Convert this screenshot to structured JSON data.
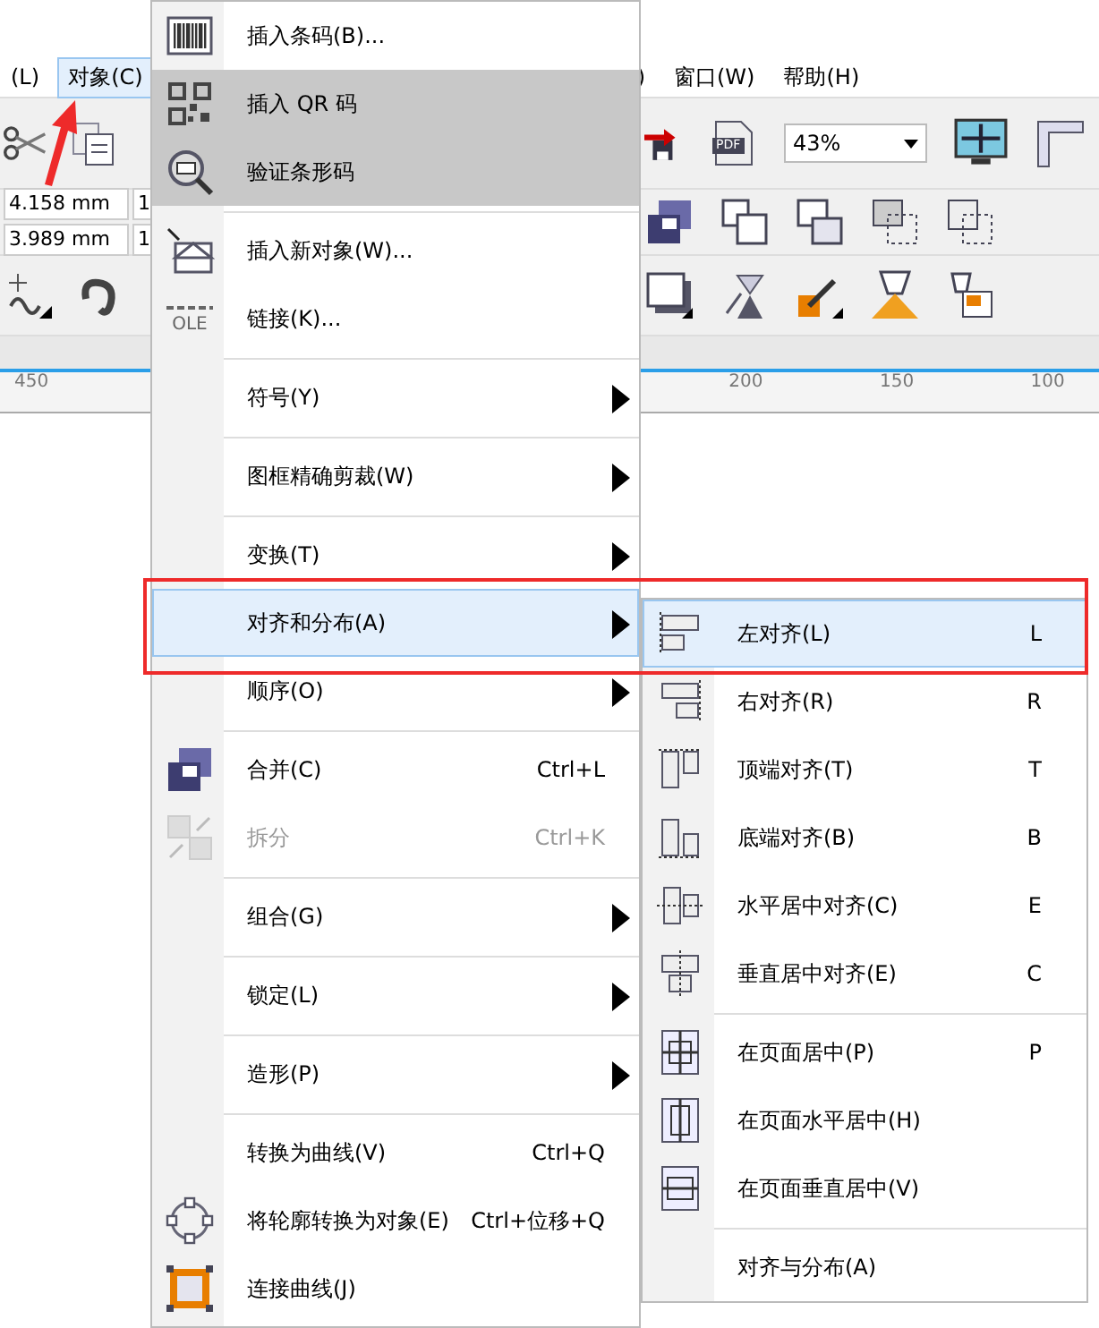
{
  "menubar": {
    "items": [
      {
        "label": "(L)",
        "selected": false
      },
      {
        "label": "对象(C)",
        "selected": true
      },
      {
        "label": ")",
        "selected": false
      },
      {
        "label": "窗口(W)",
        "selected": false
      },
      {
        "label": "帮助(H)",
        "selected": false
      }
    ]
  },
  "toolbar": {
    "zoom": "43%",
    "pdf_label": "PDF",
    "fields": [
      "4.158 mm",
      "1",
      "3.989 mm",
      "1"
    ]
  },
  "ruler": {
    "labels": [
      "450",
      "200",
      "150",
      "100"
    ]
  },
  "menu": {
    "items": [
      {
        "kind": "item",
        "label": "插入条码(B)...",
        "submenu": false,
        "selected": false,
        "disabled": false,
        "shaded": false
      },
      {
        "kind": "item",
        "label": "插入 QR 码",
        "submenu": false,
        "selected": false,
        "disabled": false,
        "shaded": true
      },
      {
        "kind": "item",
        "label": "验证条形码",
        "submenu": false,
        "selected": false,
        "disabled": false,
        "shaded": true
      },
      {
        "kind": "separator"
      },
      {
        "kind": "item",
        "label": "插入新对象(W)...",
        "submenu": false,
        "selected": false,
        "disabled": false,
        "shaded": false
      },
      {
        "kind": "item",
        "label": "链接(K)...",
        "icon_label": "OLE",
        "submenu": false,
        "selected": false,
        "disabled": false,
        "shaded": false
      },
      {
        "kind": "separator"
      },
      {
        "kind": "item",
        "label": "符号(Y)",
        "submenu": true,
        "selected": false,
        "disabled": false,
        "shaded": false
      },
      {
        "kind": "separator"
      },
      {
        "kind": "item",
        "label": "图框精确剪裁(W)",
        "submenu": true,
        "selected": false,
        "disabled": false,
        "shaded": false
      },
      {
        "kind": "separator"
      },
      {
        "kind": "item",
        "label": "变换(T)",
        "submenu": true,
        "selected": false,
        "disabled": false,
        "shaded": false
      },
      {
        "kind": "item",
        "label": "对齐和分布(A)",
        "submenu": true,
        "selected": true,
        "disabled": false,
        "shaded": false
      },
      {
        "kind": "item",
        "label": "顺序(O)",
        "submenu": true,
        "selected": false,
        "disabled": false,
        "shaded": false
      },
      {
        "kind": "separator"
      },
      {
        "kind": "item",
        "label": "合并(C)",
        "shortcut": "Ctrl+L",
        "submenu": false,
        "selected": false,
        "disabled": false,
        "shaded": false
      },
      {
        "kind": "item",
        "label": "拆分",
        "shortcut": "Ctrl+K",
        "submenu": false,
        "selected": false,
        "disabled": true,
        "shaded": false
      },
      {
        "kind": "separator"
      },
      {
        "kind": "item",
        "label": "组合(G)",
        "submenu": true,
        "selected": false,
        "disabled": false,
        "shaded": false
      },
      {
        "kind": "separator"
      },
      {
        "kind": "item",
        "label": "锁定(L)",
        "submenu": true,
        "selected": false,
        "disabled": false,
        "shaded": false
      },
      {
        "kind": "separator"
      },
      {
        "kind": "item",
        "label": "造形(P)",
        "submenu": true,
        "selected": false,
        "disabled": false,
        "shaded": false
      },
      {
        "kind": "separator"
      },
      {
        "kind": "item",
        "label": "转换为曲线(V)",
        "shortcut": "Ctrl+Q",
        "submenu": false,
        "selected": false,
        "disabled": false,
        "shaded": false
      },
      {
        "kind": "item",
        "label": "将轮廓转换为对象(E)",
        "shortcut": "Ctrl+位移+Q",
        "submenu": false,
        "selected": false,
        "disabled": false,
        "shaded": false
      },
      {
        "kind": "item",
        "label": "连接曲线(J)",
        "submenu": false,
        "selected": false,
        "disabled": false,
        "shaded": false
      }
    ]
  },
  "submenu": {
    "items": [
      {
        "kind": "item",
        "label": "左对齐(L)",
        "shortcut": "L",
        "selected": true
      },
      {
        "kind": "item",
        "label": "右对齐(R)",
        "shortcut": "R",
        "selected": false
      },
      {
        "kind": "item",
        "label": "顶端对齐(T)",
        "shortcut": "T",
        "selected": false
      },
      {
        "kind": "item",
        "label": "底端对齐(B)",
        "shortcut": "B",
        "selected": false
      },
      {
        "kind": "item",
        "label": "水平居中对齐(C)",
        "shortcut": "E",
        "selected": false
      },
      {
        "kind": "item",
        "label": "垂直居中对齐(E)",
        "shortcut": "C",
        "selected": false
      },
      {
        "kind": "separator"
      },
      {
        "kind": "item",
        "label": "在页面居中(P)",
        "shortcut": "P",
        "selected": false
      },
      {
        "kind": "item",
        "label": "在页面水平居中(H)",
        "selected": false
      },
      {
        "kind": "item",
        "label": "在页面垂直居中(V)",
        "selected": false
      },
      {
        "kind": "separator"
      },
      {
        "kind": "item",
        "label": "对齐与分布(A)",
        "selected": false
      }
    ]
  }
}
